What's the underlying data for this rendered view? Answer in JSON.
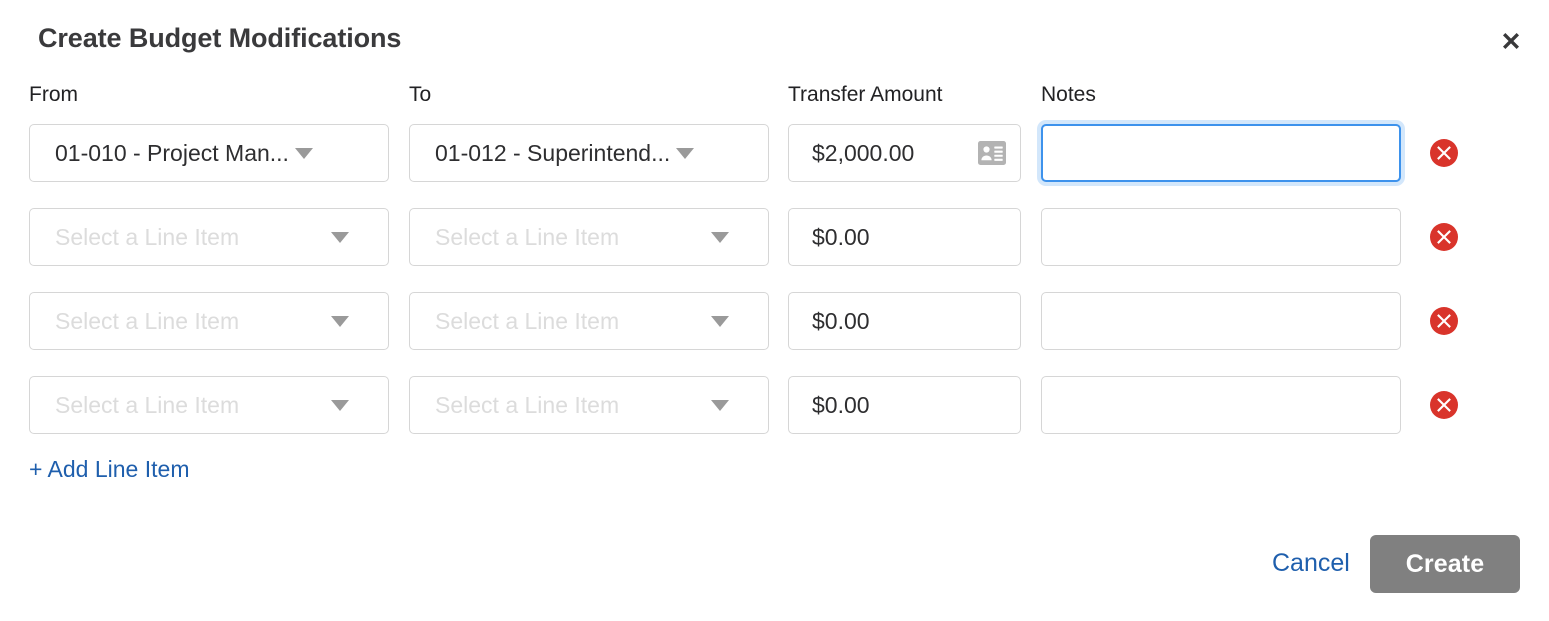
{
  "dialog": {
    "title": "Create Budget Modifications",
    "close_icon": "close-x-icon"
  },
  "columns": {
    "from": "From",
    "to": "To",
    "transfer_amount": "Transfer Amount",
    "notes": "Notes"
  },
  "placeholders": {
    "line_item": "Select a Line Item",
    "notes": ""
  },
  "rows": [
    {
      "from": "01-010 - Project Man...",
      "from_is_placeholder": false,
      "to": "01-012 - Superintend...",
      "to_is_placeholder": false,
      "amount": "$2,000.00",
      "has_amount_icon": true,
      "amount_icon": "contact-card-icon",
      "notes": "",
      "notes_focused": true,
      "delete_icon": "delete-circle-x-icon"
    },
    {
      "from": "Select a Line Item",
      "from_is_placeholder": true,
      "to": "Select a Line Item",
      "to_is_placeholder": true,
      "amount": "$0.00",
      "has_amount_icon": false,
      "amount_icon": "",
      "notes": "",
      "notes_focused": false,
      "delete_icon": "delete-circle-x-icon"
    },
    {
      "from": "Select a Line Item",
      "from_is_placeholder": true,
      "to": "Select a Line Item",
      "to_is_placeholder": true,
      "amount": "$0.00",
      "has_amount_icon": false,
      "amount_icon": "",
      "notes": "",
      "notes_focused": false,
      "delete_icon": "delete-circle-x-icon"
    },
    {
      "from": "Select a Line Item",
      "from_is_placeholder": true,
      "to": "Select a Line Item",
      "to_is_placeholder": true,
      "amount": "$0.00",
      "has_amount_icon": false,
      "amount_icon": "",
      "notes": "",
      "notes_focused": false,
      "delete_icon": "delete-circle-x-icon"
    }
  ],
  "add_line_item": "+ Add Line Item",
  "footer": {
    "cancel": "Cancel",
    "create": "Create"
  },
  "colors": {
    "link_blue": "#1f5fad",
    "focus_blue": "#3d92ec",
    "delete_red": "#d9342b",
    "create_gray": "#808080",
    "border_gray": "#d6d6d6",
    "placeholder_gray": "#dcdcdc"
  },
  "layout": {
    "row_top_start": 124,
    "row_pitch": 84
  }
}
